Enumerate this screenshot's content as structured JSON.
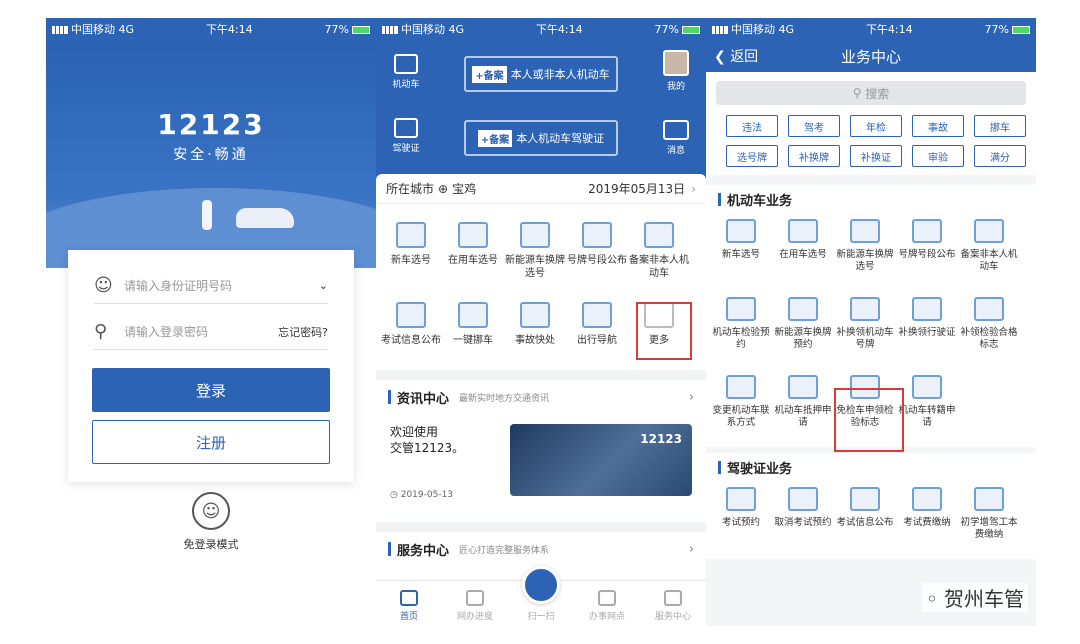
{
  "colors": {
    "brand": "#2d63b4",
    "highlight": "#d93a3a"
  },
  "status": {
    "carrier": "中国移动",
    "network": "4G",
    "time": "下午4:14",
    "battery": "77%"
  },
  "login": {
    "logo": "12123",
    "slogan": "安全·畅通",
    "id_placeholder": "请输入身份证明号码",
    "pwd_placeholder": "请输入登录密码",
    "forgot": "忘记密码?",
    "login_btn": "登录",
    "register_btn": "注册",
    "guest": "免登录模式"
  },
  "home": {
    "nav_vehicle": "机动车",
    "nav_license": "驾驶证",
    "nav_mine": "我的",
    "nav_msg": "消息",
    "bei1_tag": "+备案",
    "bei1": "本人或非本人机动车",
    "bei2_tag": "+备案",
    "bei2": "本人机动车驾驶证",
    "city_label": "所在城市",
    "city": "宝鸡",
    "date": "2019年05月13日",
    "services": [
      "新车选号",
      "在用车选号",
      "新能源车换牌选号",
      "号牌号段公布",
      "备案非本人机动车",
      "考试信息公布",
      "一键挪车",
      "事故快处",
      "出行导航",
      "更多"
    ],
    "news_title": "资讯中心",
    "news_sub": "最新实时地方交通资讯",
    "news_text1": "欢迎使用",
    "news_text2": "交管12123。",
    "news_date": "2019-05-13",
    "news_img_text": "12123",
    "svc_title": "服务中心",
    "svc_sub": "匠心打造完整服务体系",
    "tabs": [
      "首页",
      "网办进度",
      "扫一扫",
      "办事网点",
      "服务中心"
    ]
  },
  "center": {
    "back": "返回",
    "title": "业务中心",
    "search": "搜索",
    "chips": [
      "违法",
      "驾考",
      "年检",
      "事故",
      "挪车",
      "选号牌",
      "补换牌",
      "补换证",
      "审验",
      "满分"
    ],
    "vehicle_title": "机动车业务",
    "vehicle_items": [
      "新车选号",
      "在用车选号",
      "新能源车换牌选号",
      "号牌号段公布",
      "备案非本人机动车",
      "机动车检验预约",
      "新能源车换牌预约",
      "补换领机动车号牌",
      "补换领行驶证",
      "补领检验合格标志",
      "变更机动车联系方式",
      "机动车抵押申请",
      "免检车申领检验标志",
      "机动车转籍申请"
    ],
    "license_title": "驾驶证业务",
    "license_items": [
      "考试预约",
      "取消考试预约",
      "考试信息公布",
      "考试费缴纳",
      "初学增驾工本费缴纳"
    ],
    "watermark": "贺州车管"
  }
}
